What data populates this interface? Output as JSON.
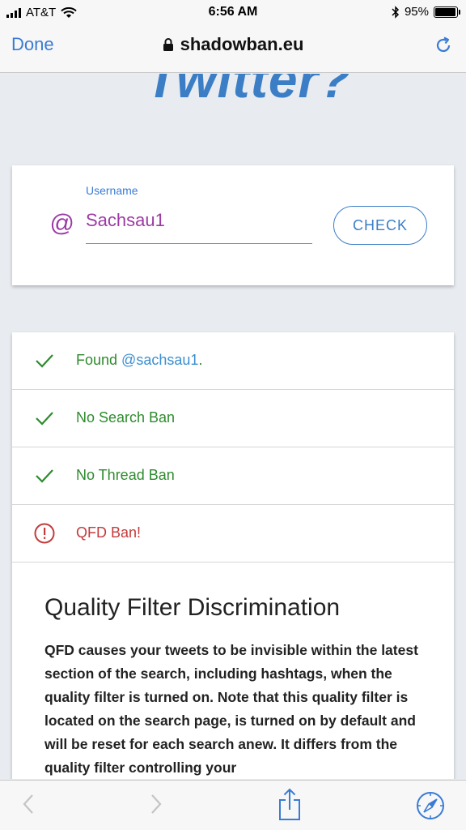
{
  "status_bar": {
    "carrier": "AT&T",
    "time": "6:56 AM",
    "battery": "95%",
    "battery_level": 0.95
  },
  "browser": {
    "done_label": "Done",
    "url": "shadowban.eu"
  },
  "page": {
    "logo_fragment": "Twitter?",
    "username_label": "Username",
    "at_symbol": "@",
    "username_value": "Sachsau1",
    "check_label": "CHECK",
    "results": [
      {
        "status": "ok",
        "text": "Found ",
        "link": "@sachsau1",
        "suffix": "."
      },
      {
        "status": "ok",
        "text": "No Search Ban"
      },
      {
        "status": "ok",
        "text": "No Thread Ban"
      },
      {
        "status": "error",
        "text": "QFD Ban!"
      }
    ],
    "qfd_title": "Quality Filter Discrimination",
    "qfd_body": "QFD causes your tweets to be invisible within the latest section of the search, including hashtags, when the quality filter is turned on. Note that this quality filter is located on the search page, is turned on by default and will be reset for each search anew. It differs from the quality filter controlling your"
  },
  "colors": {
    "accent": "#3b7ec6",
    "ok": "#2e8b2e",
    "error": "#c33b3b",
    "username": "#9c3aa6"
  },
  "toolbar": {
    "icons": [
      "chevron-left-icon",
      "chevron-right-icon",
      "share-icon",
      "compass-icon"
    ]
  }
}
